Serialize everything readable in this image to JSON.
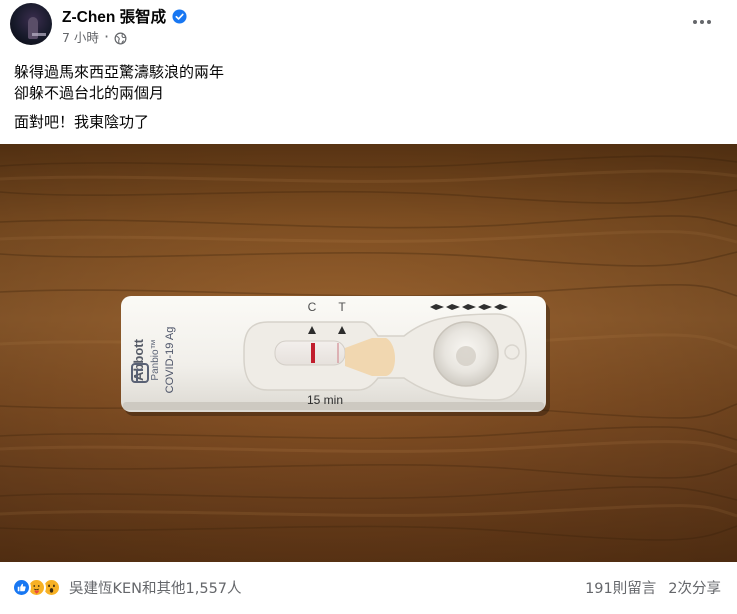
{
  "post": {
    "author": "Z-Chen 張智成",
    "timestamp": "7 小時",
    "verified": true,
    "privacy_icon": "globe-icon",
    "menu_icon": "more-options-icon",
    "text": {
      "line1": "躲得過馬來西亞驚濤駭浪的兩年",
      "line2": "卻躲不過台北的兩個月",
      "line3": "面對吧！我東陰功了"
    }
  },
  "photo": {
    "test_brand": "Abbott",
    "test_product": "Panbio™",
    "test_name": "COVID-19 Ag",
    "marker_c": "C",
    "marker_t": "T",
    "timer_label": "15 min"
  },
  "footer": {
    "reaction_icons": [
      "like-reaction-icon",
      "care-reaction-icon",
      "wow-reaction-icon"
    ],
    "reaction_names": "吳建恆KEN和其他1,557人",
    "comments": "191則留言",
    "shares": "2次分享"
  },
  "colors": {
    "text_primary": "#050505",
    "text_secondary": "#65676b",
    "facebook_blue": "#1877f2",
    "wood": "#8a5425"
  }
}
